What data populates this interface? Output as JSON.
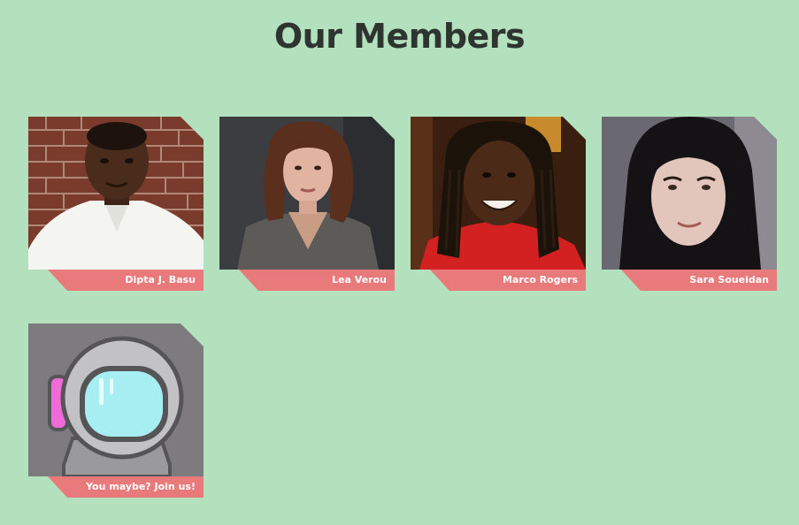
{
  "page": {
    "title": "Our Members"
  },
  "members": [
    {
      "name": "Dipta J. Basu",
      "photo": "avatar-photo"
    },
    {
      "name": "Lea Verou",
      "photo": "avatar-photo"
    },
    {
      "name": "Marco Rogers",
      "photo": "avatar-photo"
    },
    {
      "name": "Sara Soueidan",
      "photo": "avatar-photo"
    }
  ],
  "join": {
    "label": "You maybe? Join us!",
    "icon": "astronaut-helmet-icon"
  },
  "colors": {
    "background": "#b3e0bd",
    "label_band": "#e97a7b",
    "title": "#2e3430"
  }
}
